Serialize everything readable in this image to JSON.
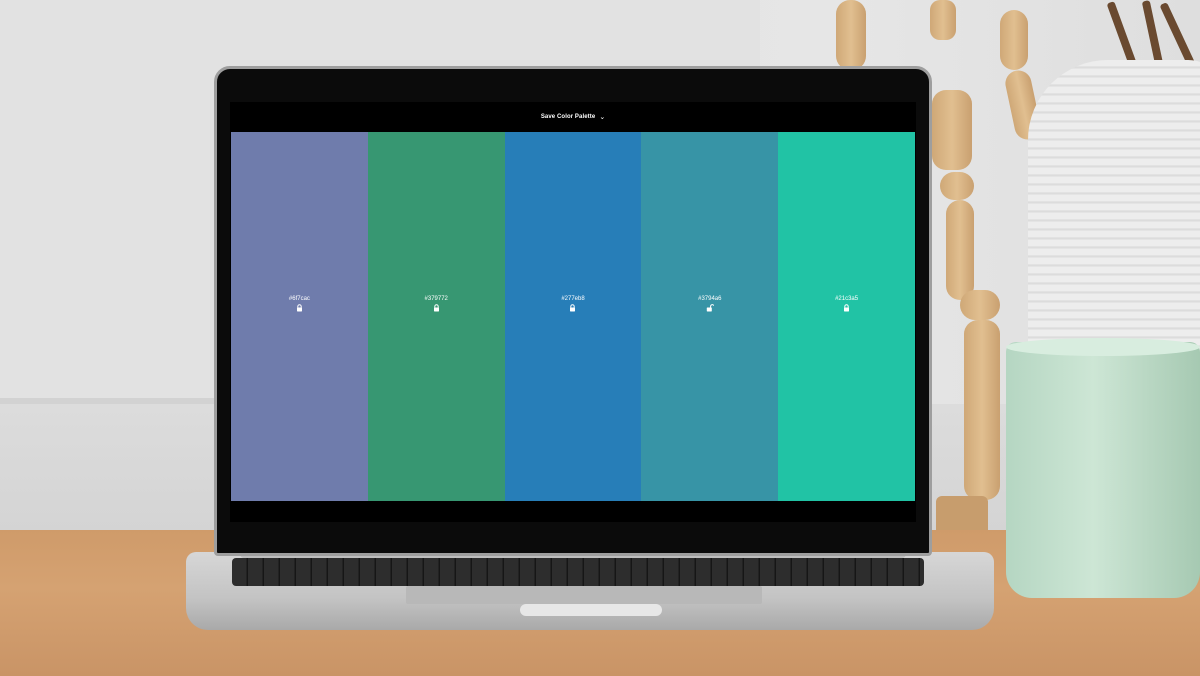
{
  "app": {
    "header": {
      "title": "Save Color Palette",
      "menu_icon": "chevron-down-icon"
    },
    "palette": [
      {
        "hex": "#6f7cac",
        "color": "#6f7cac",
        "locked": true,
        "lock_icon": "lock-icon"
      },
      {
        "hex": "#379772",
        "color": "#379772",
        "locked": true,
        "lock_icon": "lock-icon"
      },
      {
        "hex": "#277eb8",
        "color": "#277eb8",
        "locked": true,
        "lock_icon": "lock-icon"
      },
      {
        "hex": "#3794a6",
        "color": "#3794a6",
        "locked": false,
        "lock_icon": "unlock-icon"
      },
      {
        "hex": "#21c3a5",
        "color": "#21c3a5",
        "locked": true,
        "lock_icon": "lock-icon"
      }
    ]
  }
}
